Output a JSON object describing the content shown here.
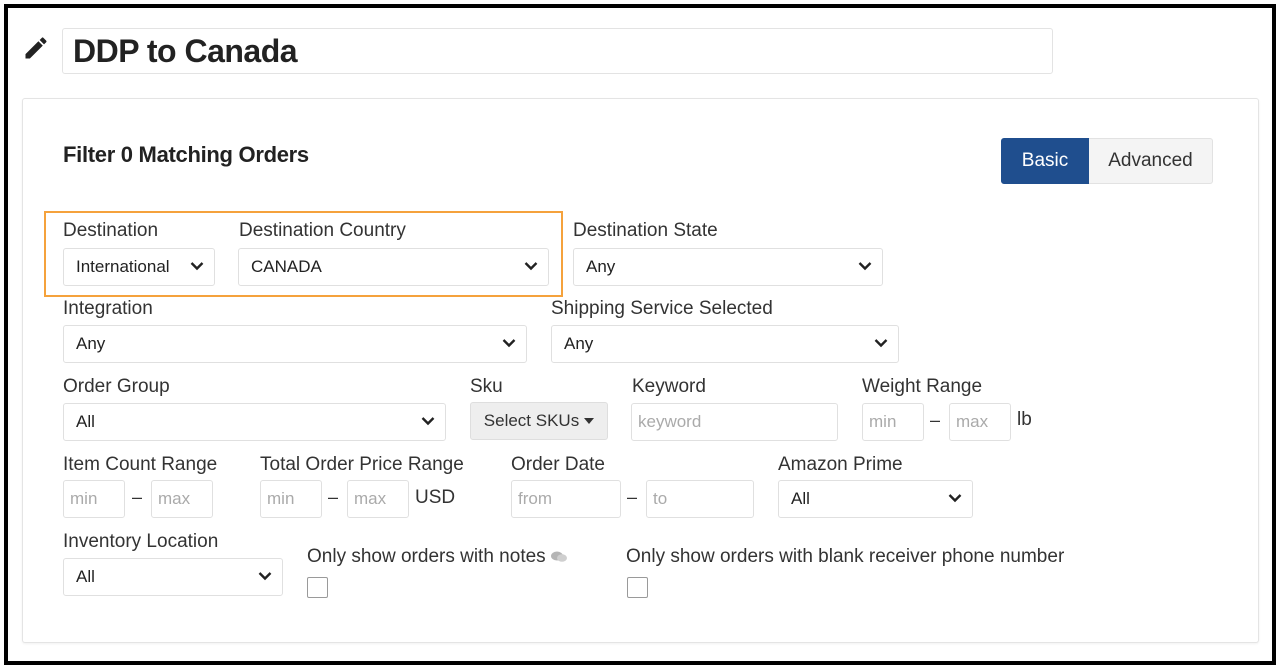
{
  "header": {
    "title": "DDP to Canada"
  },
  "filter": {
    "title": "Filter 0 Matching Orders",
    "mode_basic": "Basic",
    "mode_advanced": "Advanced"
  },
  "fields": {
    "destination": {
      "label": "Destination",
      "value": "International"
    },
    "destination_country": {
      "label": "Destination Country",
      "value": "CANADA"
    },
    "destination_state": {
      "label": "Destination State",
      "value": "Any"
    },
    "integration": {
      "label": "Integration",
      "value": "Any"
    },
    "shipping_service": {
      "label": "Shipping Service Selected",
      "value": "Any"
    },
    "order_group": {
      "label": "Order Group",
      "value": "All"
    },
    "sku": {
      "label": "Sku",
      "button": "Select SKUs"
    },
    "keyword": {
      "label": "Keyword",
      "placeholder": "keyword"
    },
    "weight_range": {
      "label": "Weight Range",
      "min_placeholder": "min",
      "max_placeholder": "max",
      "unit": "lb"
    },
    "item_count_range": {
      "label": "Item Count Range",
      "min_placeholder": "min",
      "max_placeholder": "max"
    },
    "total_price_range": {
      "label": "Total Order Price Range",
      "min_placeholder": "min",
      "max_placeholder": "max",
      "unit": "USD"
    },
    "order_date": {
      "label": "Order Date",
      "from_placeholder": "from",
      "to_placeholder": "to"
    },
    "amazon_prime": {
      "label": "Amazon Prime",
      "value": "All"
    },
    "inventory_location": {
      "label": "Inventory Location",
      "value": "All"
    },
    "only_notes": {
      "label": "Only show orders with notes"
    },
    "only_blank_phone": {
      "label": "Only show orders with blank receiver phone number"
    }
  },
  "separators": {
    "dash": "–"
  },
  "colors": {
    "primary": "#1f4e8e",
    "highlight": "#f5a23c"
  }
}
